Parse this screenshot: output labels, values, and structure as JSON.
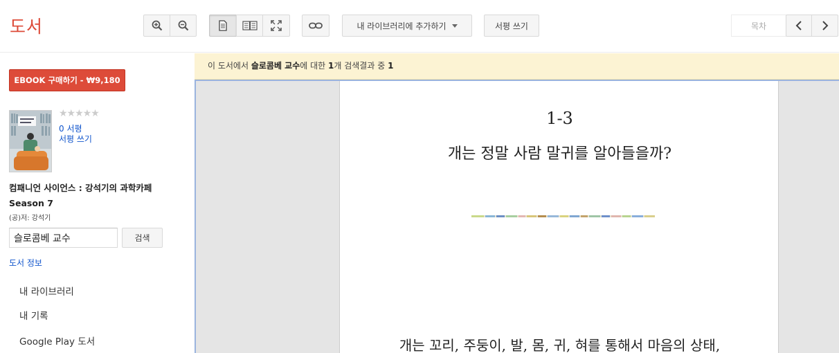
{
  "app": {
    "logo": "도서"
  },
  "toolbar": {
    "zoom_in_icon": "zoom-in-icon",
    "zoom_out_icon": "zoom-out-icon",
    "single_page_icon": "single-page-icon",
    "two_page_icon": "two-page-icon",
    "fullscreen_icon": "fullscreen-icon",
    "link_icon": "link-icon",
    "add_to_library": "내 라이브러리에 추가하기",
    "write_review": "서평 쓰기",
    "toc": "목차"
  },
  "sidebar": {
    "buy_button": "EBOOK 구매하기 - ₩9,180",
    "rating_stars": "★★★★★",
    "reviews_count": "0 서평",
    "write_review": "서평 쓰기",
    "book_title": "컴패니언 사이언스 : 강석기의 과학카페 Season 7",
    "author": "(공)저: 강석기",
    "search_value": "슬로콤베 교수",
    "search_button": "검색",
    "book_info": "도서 정보",
    "nav": [
      {
        "label": "내 라이브러리"
      },
      {
        "label": "내 기록"
      },
      {
        "label": "Google Play 도서"
      }
    ]
  },
  "results": {
    "prefix": "이 도서에서 ",
    "query": "슬로콤베 교수",
    "middle": "에 대한 ",
    "count": "1",
    "suffix": "개 검색결과 중 ",
    "current": "1"
  },
  "page": {
    "chapter_number": "1-3",
    "chapter_title": "개는 정말 사람 말귀를 알아들을까?",
    "body_line": "개는 꼬리, 주둥이, 발, 몸, 귀, 혀를 통해서 마음의 상태,"
  },
  "colors": {
    "brand_red": "#dd4b39",
    "link_blue": "#1155cc",
    "results_bg": "#fcf3d3"
  }
}
